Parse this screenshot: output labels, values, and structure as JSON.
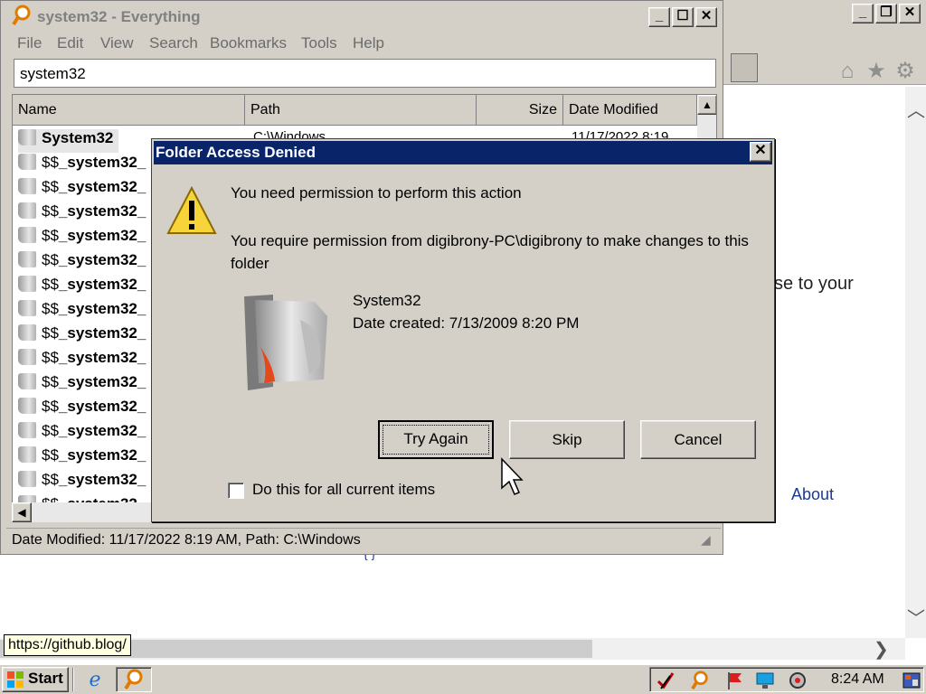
{
  "browser": {
    "body_fragment": "se to your",
    "about_link": "About",
    "bottom_fragment": "{ }",
    "status_tooltip": "https://github.blog/"
  },
  "everything": {
    "title": "system32 - Everything",
    "menu": [
      "File",
      "Edit",
      "View",
      "Search",
      "Bookmarks",
      "Tools",
      "Help"
    ],
    "search_value": "system32",
    "columns": {
      "name": "Name",
      "path": "Path",
      "size": "Size",
      "date": "Date Modified"
    },
    "first_row": {
      "name": "System32",
      "path": "C:\\Windows",
      "date": "11/17/2022 8:19"
    },
    "row_prefix": "$$",
    "row_bold": "_system32_",
    "status": "Date Modified: 11/17/2022 8:19 AM, Path: C:\\Windows"
  },
  "dialog": {
    "title": "Folder Access Denied",
    "heading": "You need permission to perform this action",
    "message": "You require permission from digibrony-PC\\digibrony to make changes to this folder",
    "folder_name": "System32",
    "date_created": "Date created: 7/13/2009 8:20 PM",
    "buttons": {
      "try_again": "Try Again",
      "skip": "Skip",
      "cancel": "Cancel"
    },
    "checkbox_label": "Do this for all current items"
  },
  "taskbar": {
    "start_label": "Start",
    "clock": "8:24 AM"
  },
  "colors": {
    "dialog_title_bg": "#0a246a",
    "chrome": "#d4d0c8"
  }
}
